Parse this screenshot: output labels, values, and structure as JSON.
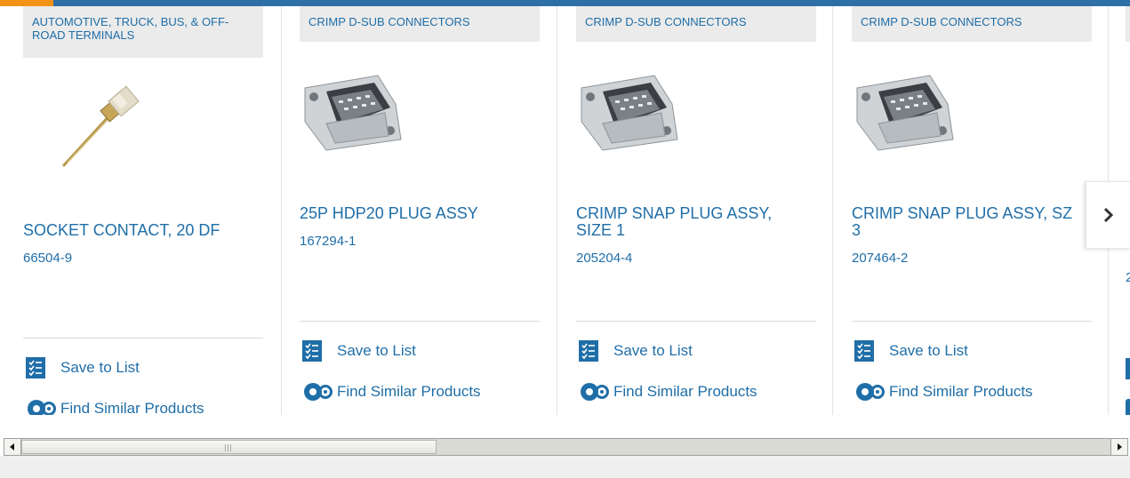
{
  "products": [
    {
      "category": "AUTOMOTIVE, TRUCK, BUS, & OFF-ROAD TERMINALS",
      "title": "SOCKET CONTACT, 20 DF",
      "part_number": "66504-9",
      "image_icon": "socket-contact-image",
      "save_label": "Save to List",
      "similar_label": "Find Similar Products"
    },
    {
      "category": "CRIMP D-SUB CONNECTORS",
      "title": "25P HDP20 PLUG ASSY",
      "part_number": "167294-1",
      "image_icon": "d-sub-connector-image",
      "save_label": "Save to List",
      "similar_label": "Find Similar Products"
    },
    {
      "category": "CRIMP D-SUB CONNECTORS",
      "title": "CRIMP SNAP PLUG ASSY, SIZE 1",
      "part_number": "205204-4",
      "image_icon": "d-sub-connector-image",
      "save_label": "Save to List",
      "similar_label": "Find Similar Products"
    },
    {
      "category": "CRIMP D-SUB CONNECTORS",
      "title": "CRIMP SNAP PLUG ASSY, SZ 3",
      "part_number": "207464-2",
      "image_icon": "d-sub-connector-image",
      "save_label": "Save to List",
      "similar_label": "Find Similar Products"
    }
  ],
  "partial_card": {
    "part_number_fragment": "2"
  },
  "icons": {
    "save": "checklist-icon",
    "similar": "gears-icon",
    "next": "chevron-right-icon",
    "scroll_left": "scroll-left-arrow-icon",
    "scroll_right": "scroll-right-arrow-icon"
  },
  "colors": {
    "brand_blue": "#1f6ea8",
    "top_bar": "#2f6fa8",
    "accent_orange": "#f29318",
    "category_bg": "#ebebeb"
  }
}
